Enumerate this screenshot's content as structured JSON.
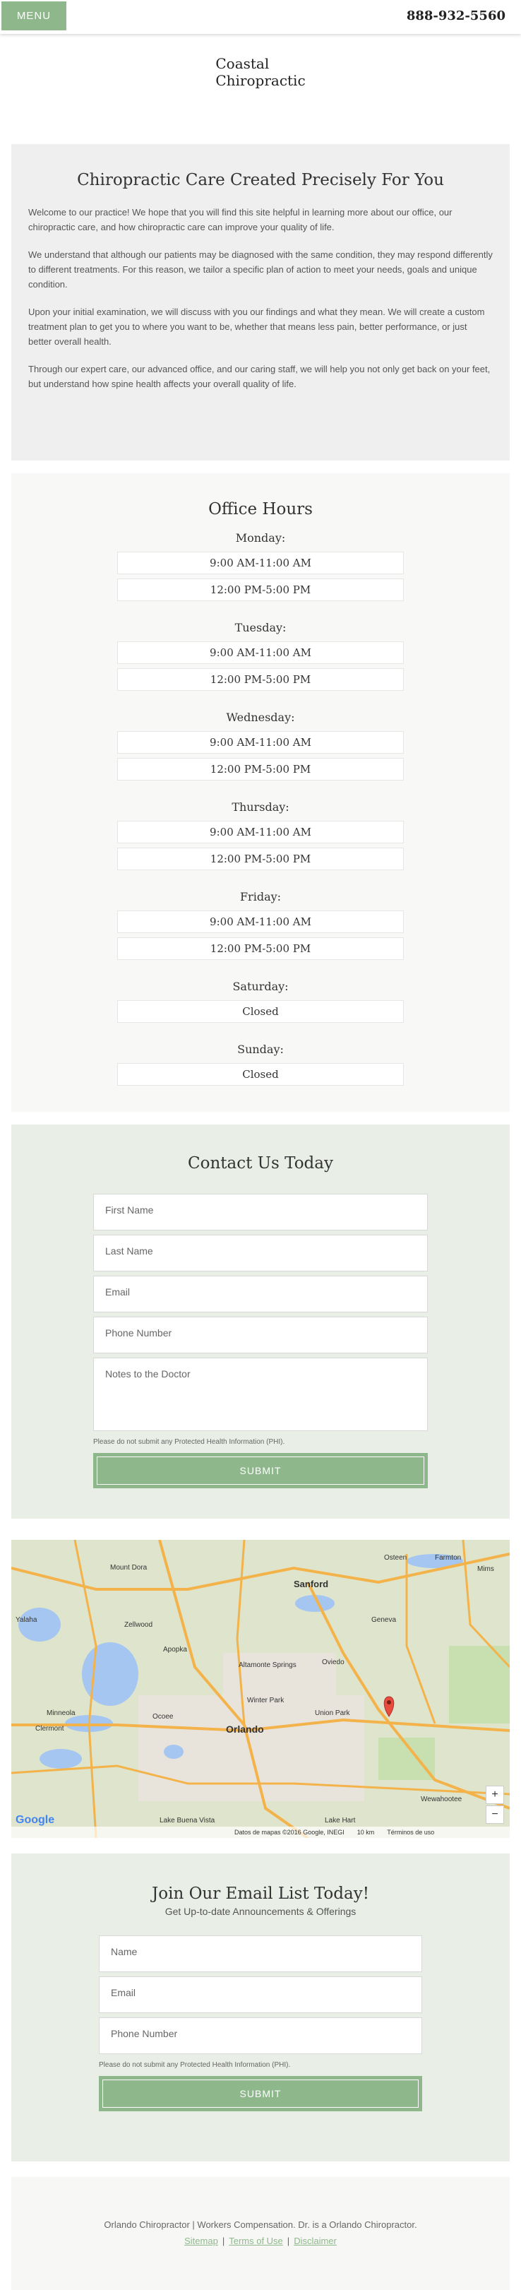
{
  "header": {
    "menu_label": "MENU",
    "phone": "888-932-5560",
    "logo_line1": "Coastal",
    "logo_line2": "Chiropractic"
  },
  "welcome": {
    "title": "Chiropractic Care Created Precisely For You",
    "paragraphs": [
      "Welcome to our practice! We hope that you will find this site helpful in learning more about our office, our chiropractic care, and how chiropractic care can improve your quality of life.",
      "We understand that although our patients may be diagnosed with the same condition, they may respond differently to different treatments. For this reason, we tailor a specific plan of action to meet your needs, goals and unique condition.",
      "Upon your initial examination, we will discuss with you our findings and what they mean. We will create a custom treatment plan to get you to where you want to be, whether that means less pain, better performance, or just better overall health.",
      "Through our expert care, our advanced office, and our caring staff, we will help you not only get back on your feet, but understand how spine health affects your overall quality of life."
    ]
  },
  "hours": {
    "title": "Office Hours",
    "days": [
      {
        "name": "Monday:",
        "slots": [
          "9:00 AM-11:00 AM",
          "12:00 PM-5:00 PM"
        ]
      },
      {
        "name": "Tuesday:",
        "slots": [
          "9:00 AM-11:00 AM",
          "12:00 PM-5:00 PM"
        ]
      },
      {
        "name": "Wednesday:",
        "slots": [
          "9:00 AM-11:00 AM",
          "12:00 PM-5:00 PM"
        ]
      },
      {
        "name": "Thursday:",
        "slots": [
          "9:00 AM-11:00 AM",
          "12:00 PM-5:00 PM"
        ]
      },
      {
        "name": "Friday:",
        "slots": [
          "9:00 AM-11:00 AM",
          "12:00 PM-5:00 PM"
        ]
      },
      {
        "name": "Saturday:",
        "slots": [
          "Closed"
        ]
      },
      {
        "name": "Sunday:",
        "slots": [
          "Closed"
        ]
      }
    ]
  },
  "contact": {
    "title": "Contact Us Today",
    "fields": {
      "first_name": "First Name",
      "last_name": "Last Name",
      "email": "Email",
      "phone": "Phone Number",
      "notes": "Notes to the Doctor"
    },
    "phi_note": "Please do not submit any Protected Health Information (PHI).",
    "submit": "SUBMIT"
  },
  "map": {
    "labels": {
      "sanford": "Sanford",
      "orlando": "Orlando",
      "apopka": "Apopka",
      "winter_park": "Winter Park",
      "oviedo": "Oviedo",
      "clermont": "Clermont",
      "kissimmee_area": "Lake Buena Vista",
      "wewahootee": "Wewahootee",
      "geneva": "Geneva",
      "mt_dora": "Mount Dora",
      "altamonte": "Altamonte Springs",
      "union_park": "Union Park",
      "zellwood": "Zellwood",
      "ocoee": "Ocoee",
      "minneola": "Minneola",
      "osteen": "Osteen",
      "farmton": "Farmton",
      "yalaha": "Yalaha",
      "mims": "Mims",
      "lake_hart": "Lake Hart"
    },
    "zoom_in": "+",
    "zoom_out": "−",
    "google": "Google",
    "attribution": "Datos de mapas ©2016 Google, INEGI",
    "scale": "10 km",
    "terms": "Términos de uso"
  },
  "newsletter": {
    "title": "Join Our Email List Today!",
    "subtitle": "Get Up-to-date Announcements & Offerings",
    "fields": {
      "name": "Name",
      "email": "Email",
      "phone": "Phone Number"
    },
    "phi_note": "Please do not submit any Protected Health Information (PHI).",
    "submit": "SUBMIT"
  },
  "footer": {
    "text": "Orlando Chiropractor | Workers Compensation. Dr. is a Orlando Chiropractor.",
    "sitemap": "Sitemap",
    "terms": "Terms of Use",
    "disclaimer": "Disclaimer",
    "sep": "|"
  },
  "colors": {
    "accent": "#8eb88c",
    "section_bg": "#efefef",
    "contact_bg": "#e9eee6"
  }
}
